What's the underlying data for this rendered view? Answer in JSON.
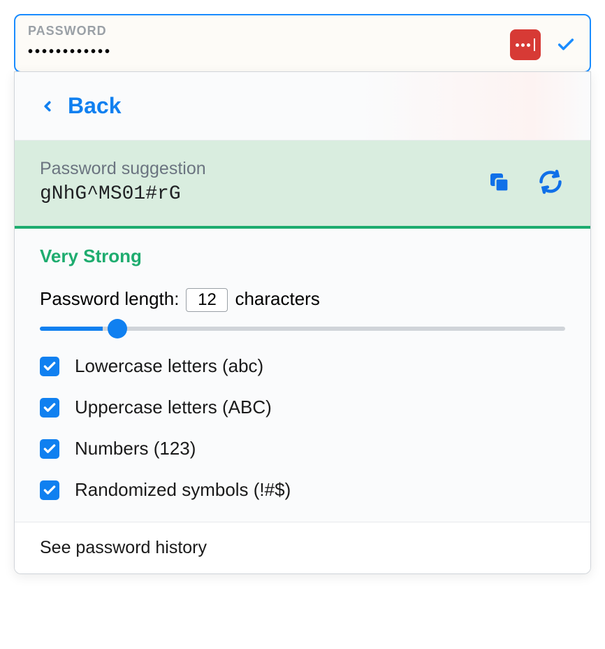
{
  "field": {
    "label": "PASSWORD",
    "masked_value": "••••••••••••"
  },
  "popup": {
    "back_label": "Back",
    "suggestion": {
      "label": "Password suggestion",
      "value": "gNhG^MS01#rG"
    },
    "strength": "Very Strong",
    "length": {
      "label_prefix": "Password length:",
      "value": "12",
      "label_suffix": "characters",
      "slider_min": "4",
      "slider_max": "64"
    },
    "options": [
      {
        "label": "Lowercase letters (abc)",
        "checked": true
      },
      {
        "label": "Uppercase letters (ABC)",
        "checked": true
      },
      {
        "label": "Numbers (123)",
        "checked": true
      },
      {
        "label": "Randomized symbols (!#$)",
        "checked": true
      }
    ],
    "history_link": "See password history"
  }
}
